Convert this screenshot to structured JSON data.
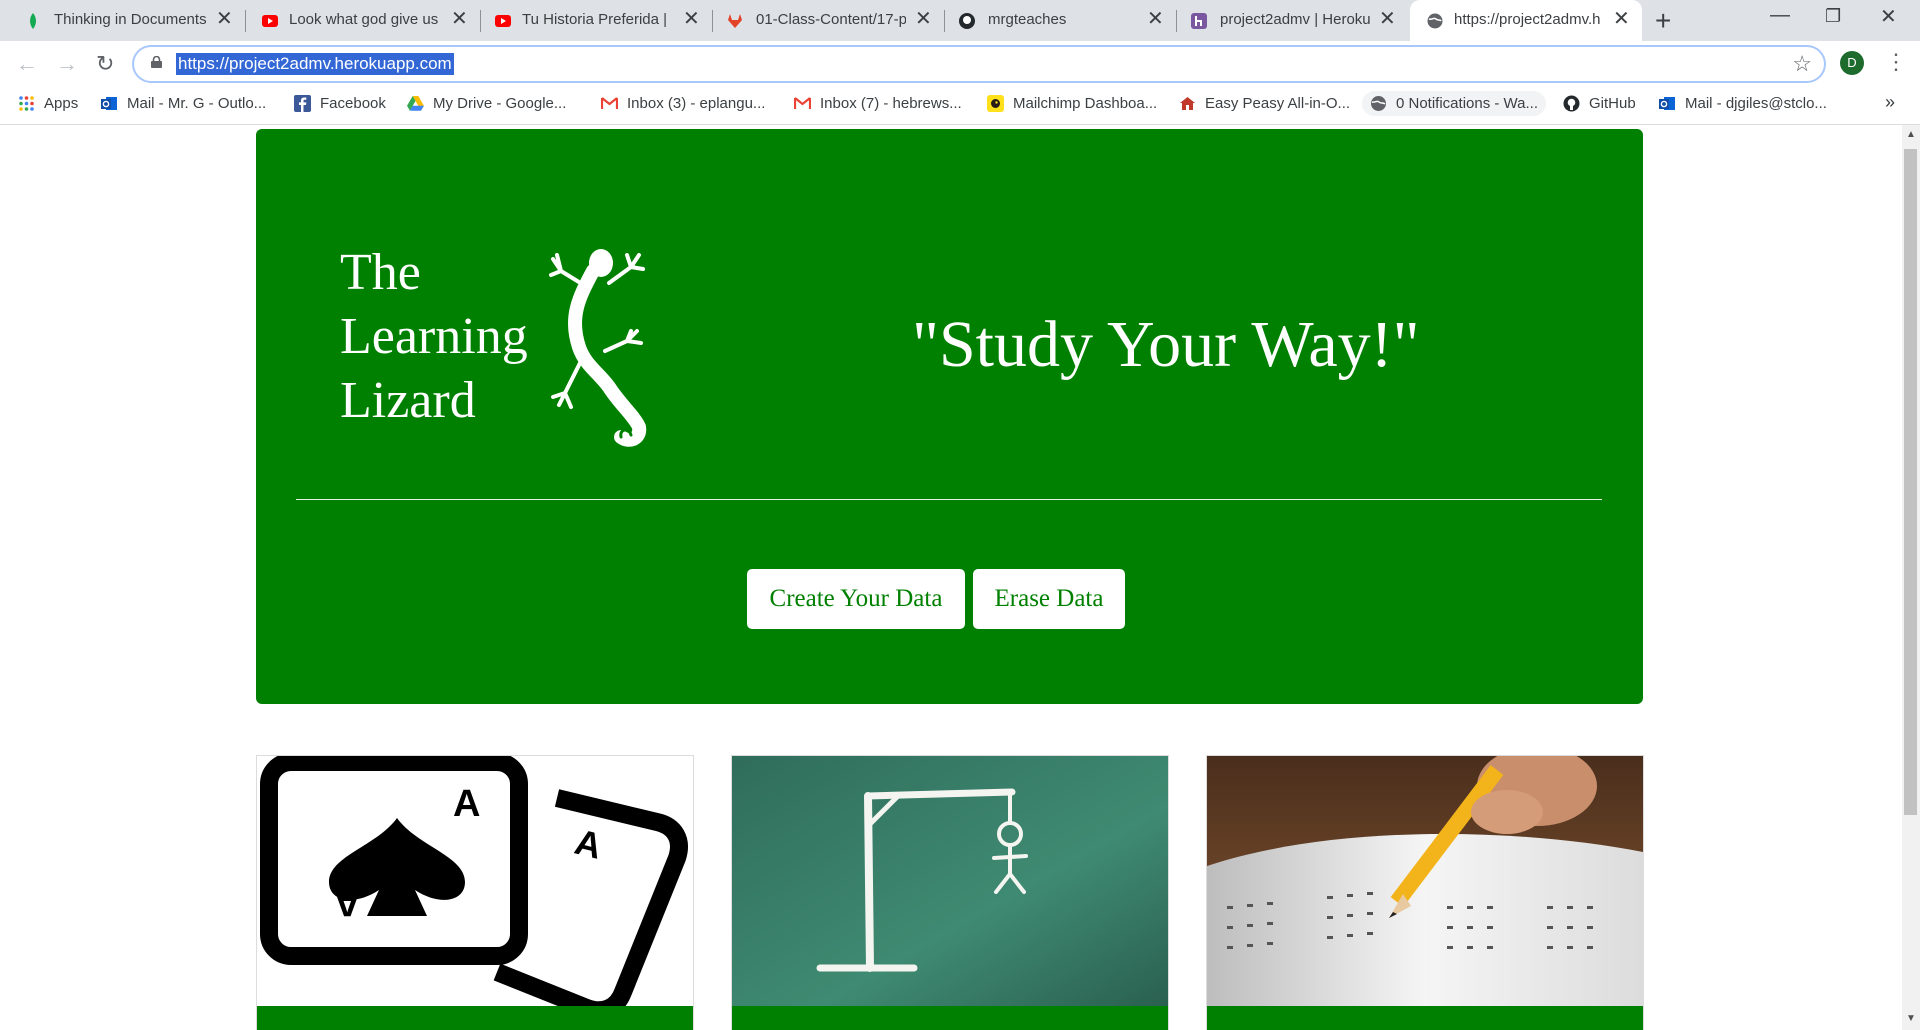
{
  "browser": {
    "tabs": [
      {
        "title": "Thinking in Documents",
        "active": false
      },
      {
        "title": "Look what god give us",
        "active": false
      },
      {
        "title": "Tu Historia Preferida | L",
        "active": false
      },
      {
        "title": "01-Class-Content/17-p",
        "active": false
      },
      {
        "title": "mrgteaches",
        "active": false
      },
      {
        "title": "project2admv | Heroku",
        "active": false
      },
      {
        "title": "https://project2admv.h",
        "active": true
      }
    ],
    "new_tab": "+",
    "url": "https://project2admv.herokuapp.com",
    "profile_initial": "D",
    "bookmarks": [
      {
        "label": "Apps",
        "icon": "apps-grid-icon"
      },
      {
        "label": "Mail - Mr. G - Outlo...",
        "icon": "outlook-icon"
      },
      {
        "label": "Facebook",
        "icon": "facebook-icon"
      },
      {
        "label": "My Drive - Google...",
        "icon": "google-drive-icon"
      },
      {
        "label": "Inbox (3) - eplangu...",
        "icon": "gmail-icon"
      },
      {
        "label": "Inbox (7) - hebrews...",
        "icon": "gmail-icon"
      },
      {
        "label": "Mailchimp Dashboa...",
        "icon": "mailchimp-icon"
      },
      {
        "label": "Easy Peasy All-in-O...",
        "icon": "schoolhouse-icon"
      },
      {
        "label": "0 Notifications - Wa...",
        "icon": "globe-icon"
      },
      {
        "label": "GitHub",
        "icon": "github-icon"
      },
      {
        "label": "Mail - djgiles@stclo...",
        "icon": "outlook-icon"
      }
    ],
    "bookmarks_more": "»"
  },
  "page": {
    "logo_lines": [
      "The",
      "Learning",
      "Lizard"
    ],
    "slogan": "\"Study Your Way!\"",
    "buttons": {
      "create": "Create Your Data",
      "erase": "Erase Data"
    },
    "cards": [
      {
        "image": "playing-cards-image"
      },
      {
        "image": "hangman-chalkboard-image"
      },
      {
        "image": "answer-sheet-pencil-image"
      }
    ]
  },
  "colors": {
    "brand_green": "#008000",
    "url_highlight": "#3367d6",
    "tabbar": "#dee1e6"
  }
}
